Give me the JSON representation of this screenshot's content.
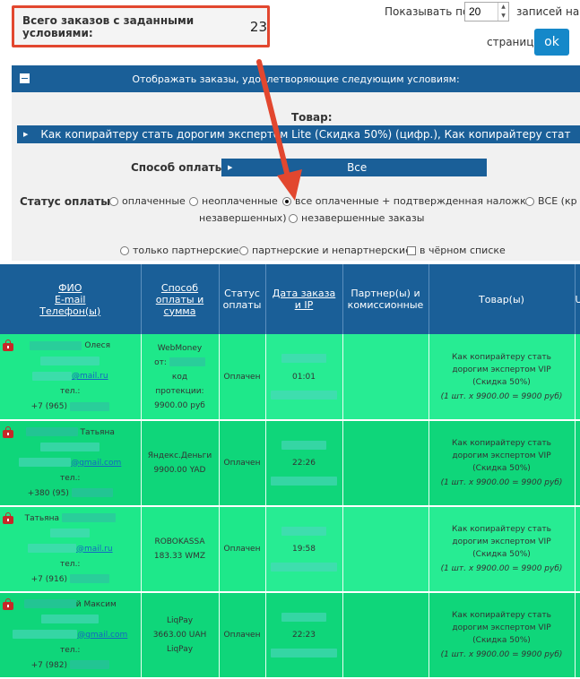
{
  "summary": {
    "total_label": "Всего заказов с заданными условиями:",
    "total_count": "23"
  },
  "pagination": {
    "show_label": "Показывать по",
    "per_page_value": "20",
    "suffix_label": "записей на",
    "page_label": "странице",
    "ok_label": "ok"
  },
  "filter": {
    "header": "Отображать заказы, удовлетворяющие следующим условиям:",
    "product_label": "Товар:",
    "product_value": "Как копирайтеру стать дорогим экспертом Lite (Скидка 50%) (цифр.), Как копирайтеру стат",
    "payment_method_label": "Способ оплаты:",
    "payment_method_value": "Все",
    "payment_status_label": "Статус оплаты:",
    "status_options": [
      "оплаченные",
      "неоплаченные",
      "все оплаченные + подтвержденная наложка",
      "ВСЕ (кр",
      "незавершенных)",
      "незавершенные заказы"
    ],
    "partner_options": [
      "только партнерские",
      "партнерские и непартнерские",
      "в чёрном списке"
    ]
  },
  "table": {
    "columns": {
      "name": [
        "ФИО",
        "E-mail",
        "Телефон(ы)"
      ],
      "payment": [
        "Способ",
        "оплаты и",
        "сумма"
      ],
      "status": [
        "Статус",
        "оплаты"
      ],
      "date": [
        "Дата заказа",
        "и IP"
      ],
      "partner": [
        "Партнер(ы) и",
        "комиссионные"
      ],
      "product": "Товар(ы)",
      "extra": "U"
    },
    "rows": [
      {
        "first_name": "Олеся",
        "email_domain": "@mail.ru",
        "phone_label": "тел.:",
        "phone_prefix": "+7 (965)",
        "payment_method": "WebMoney",
        "payment_extra": [
          "от:",
          "код",
          "протекции:"
        ],
        "amount": "9900.00 руб",
        "status": "Оплачен",
        "time": "01:01",
        "product": [
          "Как копирайтеру стать",
          "дорогим экспертом VIP",
          "(Скидка 50%)"
        ],
        "calc": "(1 шт. x 9900.00 = 9900 руб)"
      },
      {
        "first_name": "Татьяна",
        "email_domain": "@gmail.com",
        "phone_label": "тел.:",
        "phone_prefix": "+380 (95)",
        "payment_method": "Яндекс.Деньги",
        "amount": "9900.00 YAD",
        "status": "Оплачен",
        "time": "22:26",
        "product": [
          "Как копирайтеру стать",
          "дорогим экспертом VIP",
          "(Скидка 50%)"
        ],
        "calc": "(1 шт. x 9900.00 = 9900 руб)"
      },
      {
        "first_name": "Татьяна",
        "email_domain": "@mail.ru",
        "phone_label": "тел.:",
        "phone_prefix": "+7 (916)",
        "payment_method": "ROBOKASSA",
        "amount": "183.33 WMZ",
        "status": "Оплачен",
        "time": "19:58",
        "product": [
          "Как копирайтеру стать",
          "дорогим экспертом VIP",
          "(Скидка 50%)"
        ],
        "calc": "(1 шт. x 9900.00 = 9900 руб)"
      },
      {
        "first_name": "й Максим",
        "email_domain": "@gmail.com",
        "phone_label": "тел.:",
        "phone_prefix": "+7 (982)",
        "payment_method": "LiqPay",
        "amount": "3663.00 UAH",
        "amount2": "LiqPay",
        "status": "Оплачен",
        "time": "22:23",
        "product": [
          "Как копирайтеру стать",
          "дорогим экспертом VIP",
          "(Скидка 50%)"
        ],
        "calc": "(1 шт. x 9900.00 = 9900 руб)"
      }
    ]
  },
  "colors": {
    "primary": "#1a5f98",
    "accent_button": "#1588c9",
    "highlight": "#e2472f",
    "row_paid": "#1ee88a"
  }
}
